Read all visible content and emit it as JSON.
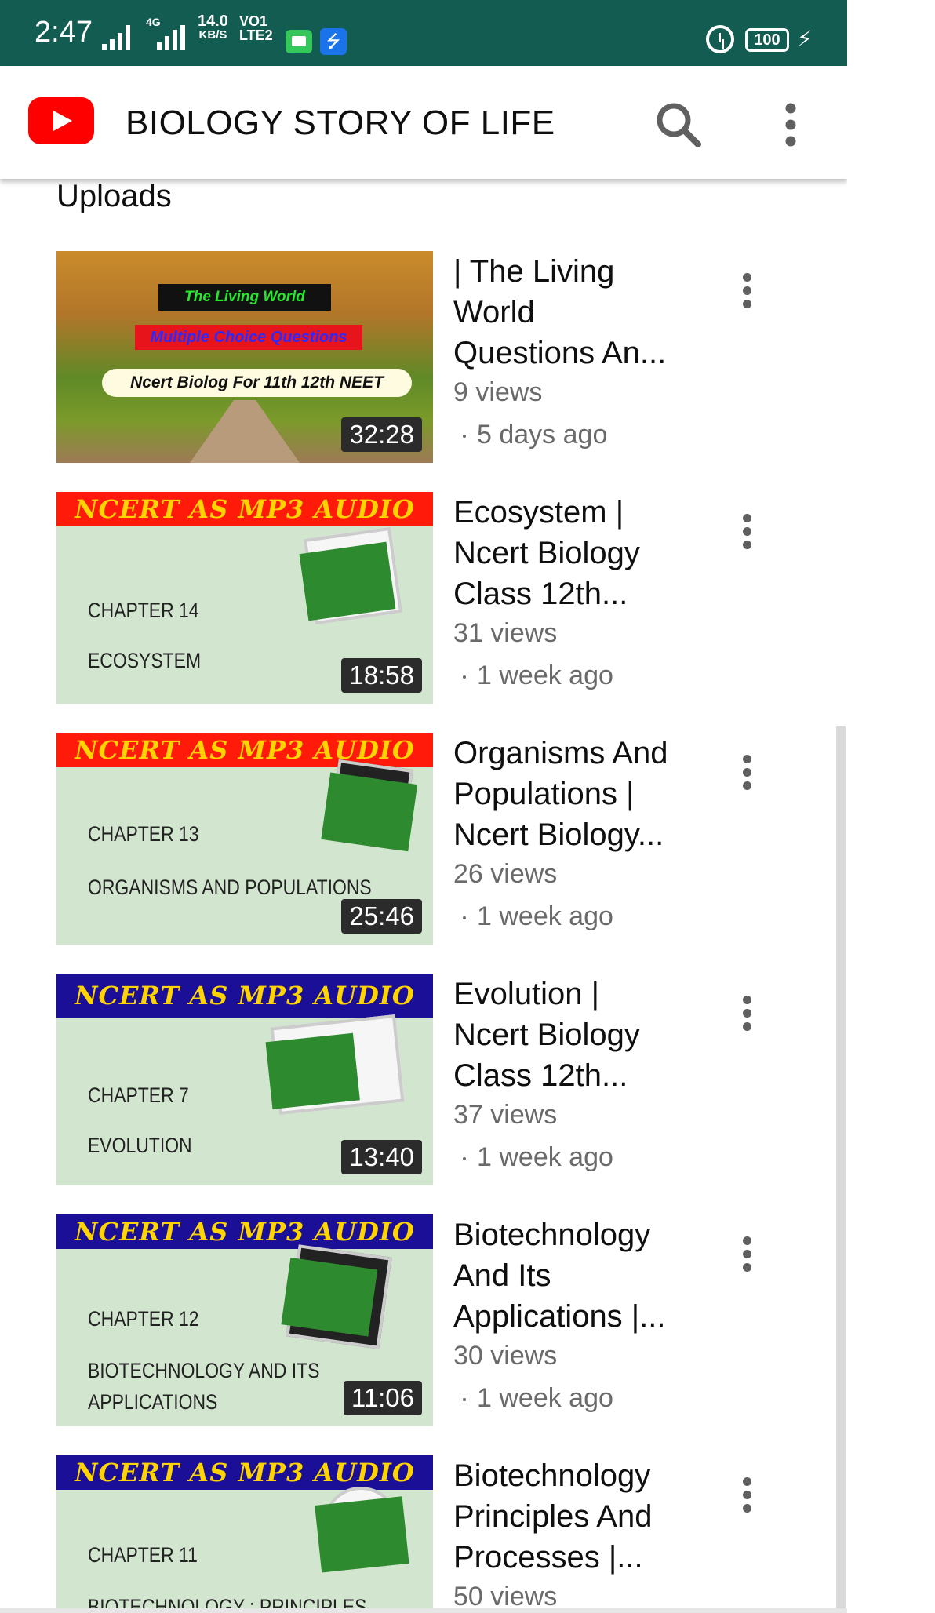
{
  "status_bar": {
    "time": "2:47",
    "network": "4G",
    "speed_value": "14.0",
    "speed_unit": "KB/S",
    "volte_line1": "VO1",
    "volte_line2": "LTE2",
    "battery": "100",
    "icons": [
      "signal-icon",
      "signal-4g-icon",
      "message-icon",
      "usb-icon",
      "alarm-icon",
      "battery-icon",
      "charging-icon"
    ]
  },
  "app_bar": {
    "title": "BIOLOGY STORY OF LIFE",
    "icons": [
      "youtube-logo",
      "search-icon",
      "more-vert-icon"
    ]
  },
  "section": {
    "title": "Uploads"
  },
  "videos": [
    {
      "title": "| The Living\nWorld\nQuestions An...",
      "views": "9 views",
      "age": "5 days ago",
      "duration": "32:28",
      "thumb": {
        "tag1": "The Living World",
        "tag2": "Multiple Choice Questions",
        "tag3": "Ncert Biolog For 11th 12th NEET"
      }
    },
    {
      "title": "Ecosystem |\nNcert Biology\nClass 12th...",
      "views": "31 views",
      "age": "1 week ago",
      "duration": "18:58",
      "thumb": {
        "banner": "NCERT AS MP3 AUDIO",
        "banner_color": "#ff1a0a",
        "chapter": "CHAPTER 14",
        "name": "ECOSYSTEM"
      }
    },
    {
      "title": "Organisms And\nPopulations |\nNcert Biology...",
      "views": "26 views",
      "age": "1 week ago",
      "duration": "25:46",
      "thumb": {
        "banner": "NCERT AS MP3 AUDIO",
        "banner_color": "#ff1a0a",
        "chapter": "CHAPTER 13",
        "name": "ORGANISMS AND POPULATIONS"
      }
    },
    {
      "title": "Evolution |\nNcert Biology\nClass 12th...",
      "views": "37 views",
      "age": "1 week ago",
      "duration": "13:40",
      "thumb": {
        "banner": "NCERT AS MP3 AUDIO",
        "banner_color": "#1a0f96",
        "chapter": "CHAPTER 7",
        "name": "EVOLUTION"
      }
    },
    {
      "title": "Biotechnology\nAnd Its\nApplications |...",
      "views": "30 views",
      "age": "1 week ago",
      "duration": "11:06",
      "thumb": {
        "banner": "NCERT AS MP3 AUDIO",
        "banner_color": "#1a0f96",
        "chapter": "CHAPTER 12",
        "name": "BIOTECHNOLOGY AND ITS",
        "name2": "APPLICATIONS"
      }
    },
    {
      "title": "Biotechnology\nPrinciples And\nProcesses |...",
      "views": "50 views",
      "thumb": {
        "banner": "NCERT AS MP3 AUDIO",
        "banner_color": "#1a0f96",
        "chapter": "CHAPTER 11",
        "name": "BIOTECHNOLOGY : PRINCIPLES"
      }
    }
  ]
}
